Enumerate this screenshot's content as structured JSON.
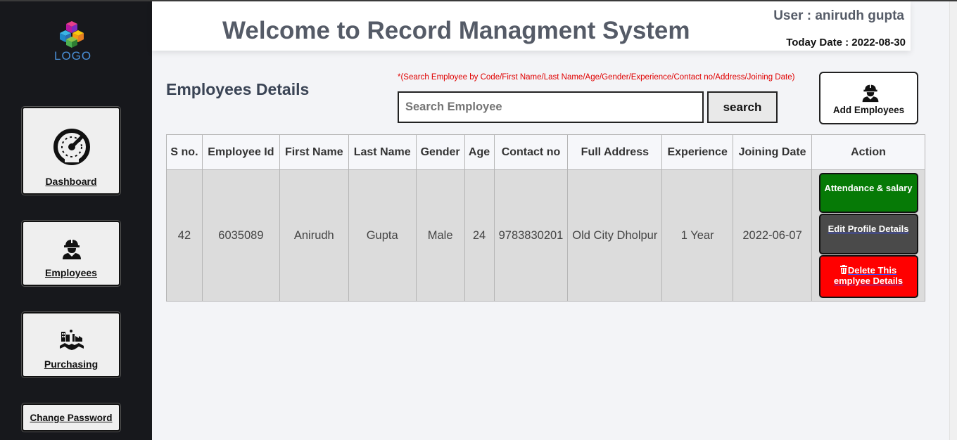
{
  "sidebar": {
    "logo_text": "LOGO",
    "items": [
      {
        "label": "Dashboard",
        "icon": "speedometer-icon"
      },
      {
        "label": "Employees",
        "icon": "worker-helmet-icon"
      },
      {
        "label": "Purchasing",
        "icon": "industry-handshake-icon"
      }
    ],
    "change_password": "Change Password"
  },
  "header": {
    "title": "Welcome to Record Managment System",
    "user": "User : anirudh gupta",
    "date": "Today Date : 2022-08-30"
  },
  "main": {
    "title": "Employees Details",
    "search_hint": "*(Search Employee by Code/First Name/Last Name/Age/Gender/Experience/Contact no/Address/Joining Date)",
    "search_placeholder": "Search Employee",
    "search_value": "",
    "search_button": "search",
    "add_button": "Add Employees"
  },
  "table": {
    "headers": [
      "S no.",
      "Employee Id",
      "First Name",
      "Last Name",
      "Gender",
      "Age",
      "Contact no",
      "Full Address",
      "Experience",
      "Joining Date",
      "Action"
    ],
    "rows": [
      {
        "sno": "42",
        "employee_id": "6035089",
        "first_name": "Anirudh",
        "last_name": "Gupta",
        "gender": "Male",
        "age": "24",
        "contact": "9783830201",
        "address": "Old City Dholpur",
        "experience": "1 Year",
        "joining_date": "2022-06-07",
        "actions": {
          "attendance": "Attendance & salary",
          "edit": "Edit Profile Details",
          "delete": "Delete This emplyee Details"
        }
      }
    ]
  },
  "colors": {
    "sidebar_bg": "#17181c",
    "attendance_btn": "#067a06",
    "edit_btn": "#4a4a4a",
    "delete_btn": "#ff0000",
    "hint_text": "#e00000"
  }
}
